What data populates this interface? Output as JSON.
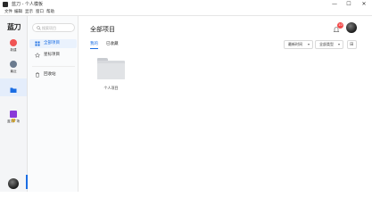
{
  "window": {
    "title": "蓝刀 - 个人模板",
    "controls": {
      "minimize": "—",
      "maximize": "☐",
      "close": "✕"
    }
  },
  "menu": [
    "文件",
    "编辑",
    "显示",
    "窗口",
    "帮助"
  ],
  "rail": {
    "logo": "蓝刀",
    "items": [
      {
        "label": "新建",
        "icon": "plus-icon",
        "color": "#f05454"
      },
      {
        "label": "最近",
        "icon": "clock-icon",
        "color": "#6b7b8f"
      },
      {
        "label": "项目",
        "icon": "folder-icon",
        "color": "#1a6de3",
        "active": true
      },
      {
        "label": "蓝刀广场",
        "icon": "plaza-icon",
        "color": "#8a3ad8"
      }
    ]
  },
  "sidebar": {
    "search_placeholder": "搜索项目",
    "items": [
      {
        "label": "全部项目",
        "icon": "grid-icon",
        "active": true
      },
      {
        "label": "星标项目",
        "icon": "star-icon"
      },
      {
        "label": "回收站",
        "icon": "trash-icon"
      }
    ]
  },
  "main": {
    "title": "全部项目",
    "notification_count": "10",
    "tabs": [
      {
        "label": "我的",
        "active": true
      },
      {
        "label": "已收藏"
      }
    ],
    "sort_select": {
      "label": "最新时间",
      "chevron": "▾"
    },
    "type_select": {
      "label": "全部类型",
      "chevron": "▾"
    },
    "grid_icon": "⊞",
    "folders": [
      {
        "label": "个人项目"
      }
    ]
  },
  "colors": {
    "accent": "#1a6de3",
    "badge": "#f24a4a",
    "new_button": "#f05454",
    "plaza": "#8a3ad8"
  }
}
